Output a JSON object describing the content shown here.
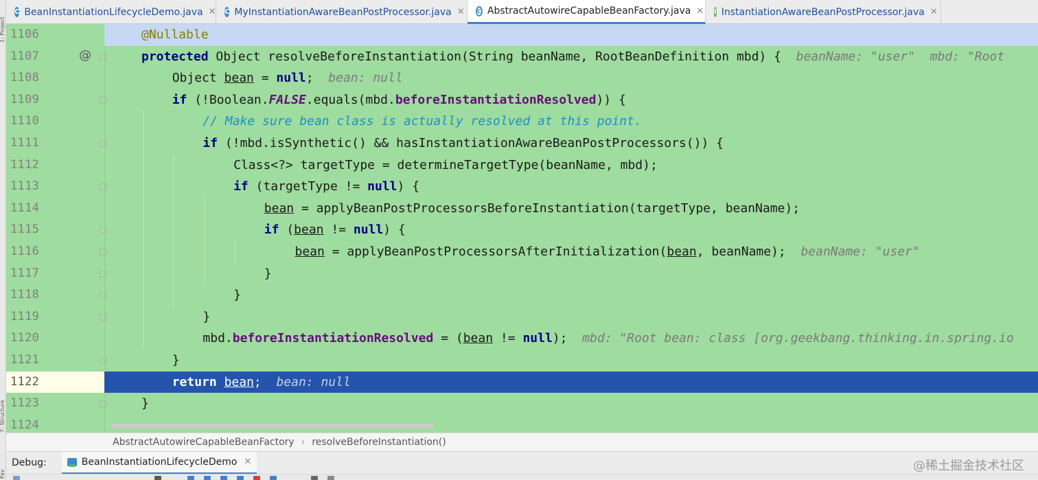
{
  "left_strip": {
    "top_label": "1: Project",
    "bottom_label": "7: Structure",
    "bottom2_label": "Fav"
  },
  "tabs": [
    {
      "title": "BeanInstantiationLifecycleDemo.java",
      "icon": "class-icon"
    },
    {
      "title": "MyInstantiationAwareBeanPostProcessor.java",
      "icon": "class-icon"
    },
    {
      "title": "AbstractAutowireCapableBeanFactory.java",
      "icon": "class-icon",
      "active": true
    },
    {
      "title": "InstantiationAwareBeanPostProcessor.java",
      "icon": "interface-icon"
    }
  ],
  "close_glyph": "✕",
  "gutter_marks": {
    "override": "@"
  },
  "lines": [
    {
      "num": "1106",
      "indent": 1,
      "parts": [
        [
          "ann",
          "@Nullable"
        ]
      ]
    },
    {
      "num": "1107",
      "indent": 1,
      "parts": [
        [
          "kw",
          "protected"
        ],
        [
          "t",
          " Object resolveBeforeInstantiation(String beanName, RootBeanDefinition mbd) {  "
        ],
        [
          "hint",
          "beanName: \"user\"  mbd: \"Root"
        ]
      ]
    },
    {
      "num": "1108",
      "indent": 2,
      "parts": [
        [
          "t",
          "Object "
        ],
        [
          "ul",
          "bean"
        ],
        [
          "t",
          " = "
        ],
        [
          "kw",
          "null"
        ],
        [
          "t",
          ";  "
        ],
        [
          "hint",
          "bean: null"
        ]
      ]
    },
    {
      "num": "1109",
      "indent": 2,
      "parts": [
        [
          "kw",
          "if"
        ],
        [
          "t",
          " (!Boolean."
        ],
        [
          "stat",
          "FALSE"
        ],
        [
          "t",
          ".equals(mbd."
        ],
        [
          "fld",
          "beforeInstantiationResolved"
        ],
        [
          "t",
          ")) {"
        ]
      ]
    },
    {
      "num": "1110",
      "indent": 3,
      "parts": [
        [
          "cmt",
          "// Make sure bean class is actually resolved at this point."
        ]
      ]
    },
    {
      "num": "1111",
      "indent": 3,
      "parts": [
        [
          "kw",
          "if"
        ],
        [
          "t",
          " (!mbd.isSynthetic() && hasInstantiationAwareBeanPostProcessors()) {"
        ]
      ]
    },
    {
      "num": "1112",
      "indent": 4,
      "parts": [
        [
          "t",
          "Class<?> targetType = determineTargetType(beanName, mbd);"
        ]
      ]
    },
    {
      "num": "1113",
      "indent": 4,
      "parts": [
        [
          "kw",
          "if"
        ],
        [
          "t",
          " (targetType != "
        ],
        [
          "kw",
          "null"
        ],
        [
          "t",
          ") {"
        ]
      ]
    },
    {
      "num": "1114",
      "indent": 5,
      "parts": [
        [
          "ul",
          "bean"
        ],
        [
          "t",
          " = applyBeanPostProcessorsBeforeInstantiation(targetType, beanName);"
        ]
      ]
    },
    {
      "num": "1115",
      "indent": 5,
      "parts": [
        [
          "kw",
          "if"
        ],
        [
          "t",
          " ("
        ],
        [
          "ul",
          "bean"
        ],
        [
          "t",
          " != "
        ],
        [
          "kw",
          "null"
        ],
        [
          "t",
          ") {"
        ]
      ]
    },
    {
      "num": "1116",
      "indent": 6,
      "parts": [
        [
          "ul",
          "bean"
        ],
        [
          "t",
          " = applyBeanPostProcessorsAfterInitialization("
        ],
        [
          "ul",
          "bean"
        ],
        [
          "t",
          ", beanName);  "
        ],
        [
          "hint",
          "beanName: \"user\""
        ]
      ]
    },
    {
      "num": "1117",
      "indent": 5,
      "parts": [
        [
          "t",
          "}"
        ]
      ]
    },
    {
      "num": "1118",
      "indent": 4,
      "parts": [
        [
          "t",
          "}"
        ]
      ]
    },
    {
      "num": "1119",
      "indent": 3,
      "parts": [
        [
          "t",
          "}"
        ]
      ]
    },
    {
      "num": "1120",
      "indent": 3,
      "parts": [
        [
          "t",
          "mbd."
        ],
        [
          "fld",
          "beforeInstantiationResolved"
        ],
        [
          "t",
          " = ("
        ],
        [
          "ul",
          "bean"
        ],
        [
          "t",
          " != "
        ],
        [
          "kw",
          "null"
        ],
        [
          "t",
          ");  "
        ],
        [
          "hint",
          "mbd: \"Root bean: class [org.geekbang.thinking.in.spring.io"
        ]
      ]
    },
    {
      "num": "1121",
      "indent": 2,
      "parts": [
        [
          "t",
          "}"
        ]
      ]
    },
    {
      "num": "1122",
      "indent": 2,
      "parts": [
        [
          "kw",
          "return"
        ],
        [
          "t",
          " "
        ],
        [
          "ul",
          "bean"
        ],
        [
          "t",
          ";  "
        ],
        [
          "hint",
          "bean: null"
        ]
      ],
      "current": true
    },
    {
      "num": "1123",
      "indent": 1,
      "parts": [
        [
          "t",
          "}"
        ]
      ]
    },
    {
      "num": "1124",
      "indent": 1,
      "parts": []
    }
  ],
  "breadcrumb": {
    "items": [
      "AbstractAutowireCapableBeanFactory",
      "resolveBeforeInstantiation()"
    ],
    "separator": "›"
  },
  "debug": {
    "label": "Debug:",
    "session": "BeanInstantiationLifecycleDemo"
  },
  "watermark": "@稀土掘金技术社区",
  "colors": {
    "editor_bg": "#9fdc9f",
    "current_line": "#2454ab",
    "first_line": "#c7d8f3",
    "keyword": "#000080",
    "comment": "#1a8fcc",
    "field": "#660e7a"
  }
}
